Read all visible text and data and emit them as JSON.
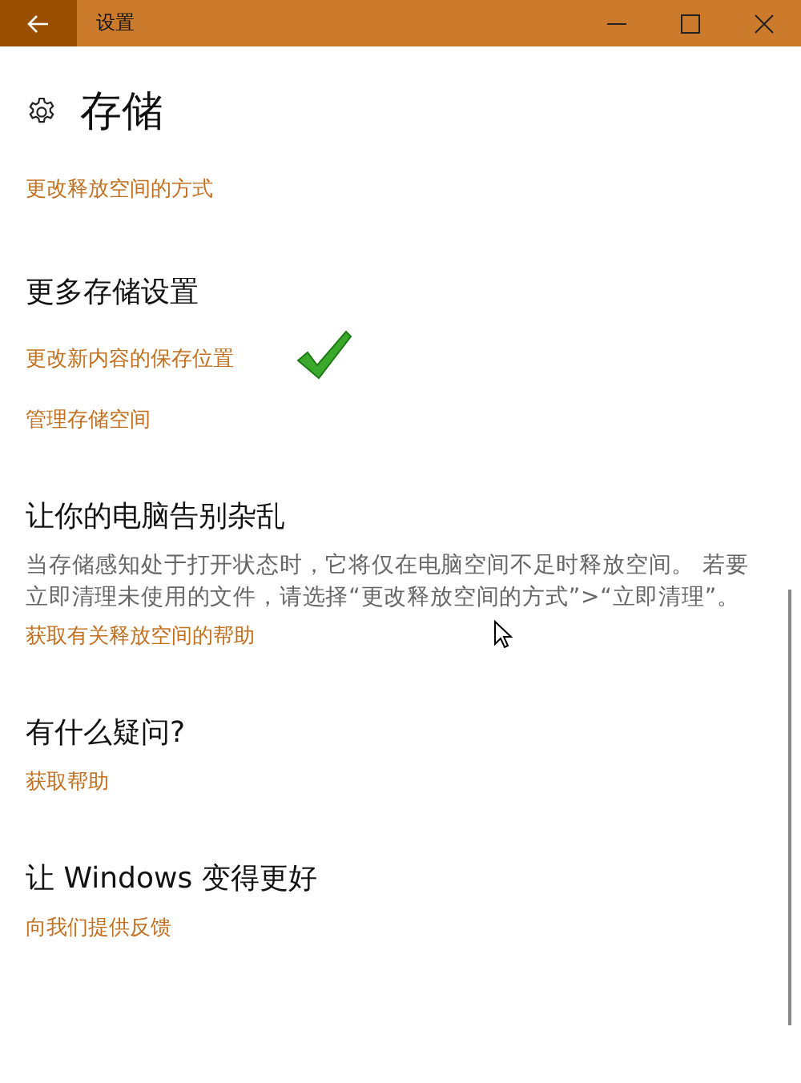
{
  "window": {
    "title": "设置"
  },
  "page": {
    "title": "存储",
    "top_link": "更改释放空间的方式"
  },
  "sections": [
    {
      "title": "更多存储设置",
      "links": [
        "更改新内容的保存位置",
        "管理存储空间"
      ]
    },
    {
      "title": "让你的电脑告别杂乱",
      "description": "当存储感知处于打开状态时，它将仅在电脑空间不足时释放空间。 若要立即清理未使用的文件，请选择“更改释放空间的方式”>“立即清理”。",
      "links": [
        "获取有关释放空间的帮助"
      ]
    },
    {
      "title": "有什么疑问?",
      "links": [
        "获取帮助"
      ]
    },
    {
      "title": "让 Windows 变得更好",
      "links": [
        "向我们提供反馈"
      ]
    }
  ]
}
